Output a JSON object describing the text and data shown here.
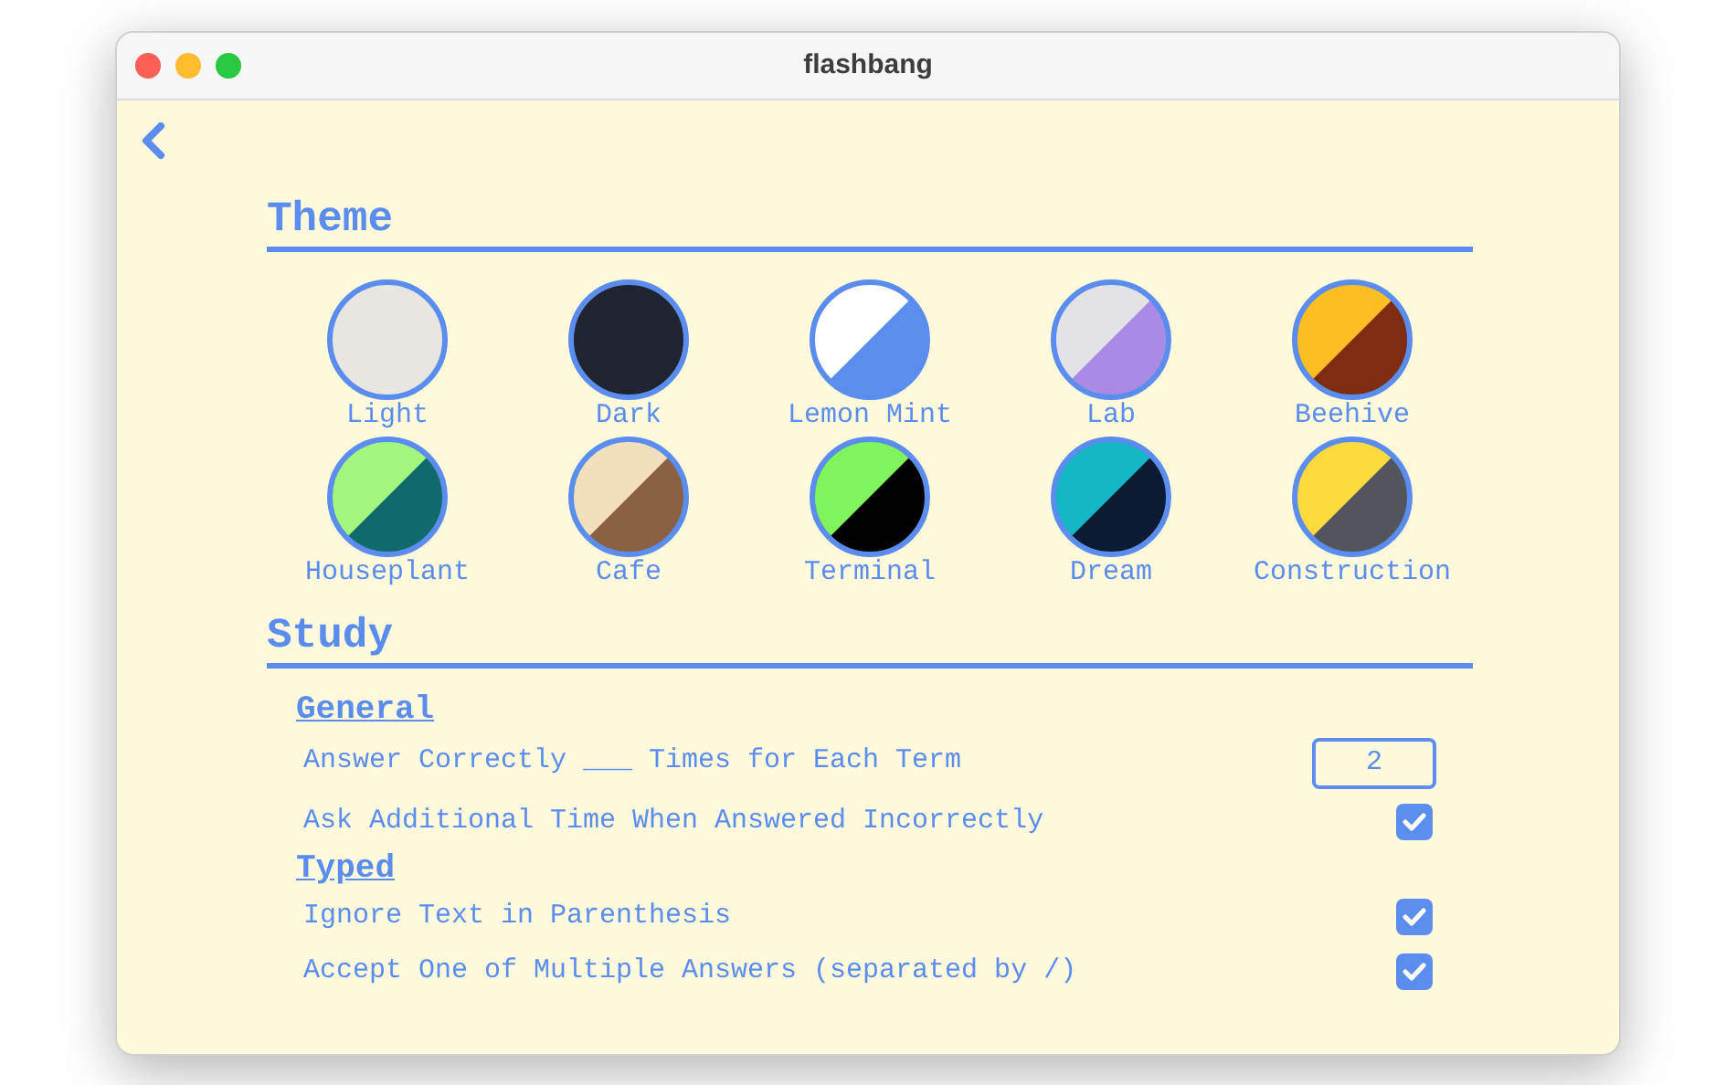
{
  "window": {
    "title": "flashbang"
  },
  "sections": [
    {
      "title": "Theme",
      "themes": [
        {
          "label": "Light",
          "halves": [
            {
              "color": "#e8e6e1"
            },
            {
              "color": "#e8e6e1"
            }
          ]
        },
        {
          "label": "Dark",
          "halves": [
            {
              "color": "#1f2430"
            },
            {
              "color": "#1f2430"
            }
          ]
        },
        {
          "label": "Lemon Mint",
          "halves": [
            {
              "color": "#ffffff"
            },
            {
              "color": "#5b8def"
            }
          ]
        },
        {
          "label": "Lab",
          "halves": [
            {
              "color": "#e3e3e6"
            },
            {
              "color": "#a98be6"
            }
          ]
        },
        {
          "label": "Beehive",
          "halves": [
            {
              "color": "#fbbf24"
            },
            {
              "color": "#7c2d12"
            }
          ]
        },
        {
          "label": "Houseplant",
          "halves": [
            {
              "color": "#a3f77f"
            },
            {
              "color": "#0f6b6b"
            }
          ]
        },
        {
          "label": "Cafe",
          "halves": [
            {
              "color": "#f2dfbe"
            },
            {
              "color": "#8a6142"
            }
          ]
        },
        {
          "label": "Terminal",
          "halves": [
            {
              "color": "#7ef55a"
            },
            {
              "color": "#000000"
            }
          ]
        },
        {
          "label": "Dream",
          "halves": [
            {
              "color": "#14b8c4"
            },
            {
              "color": "#0c1a33"
            }
          ]
        },
        {
          "label": "Construction",
          "halves": [
            {
              "color": "#fcd93c"
            },
            {
              "color": "#52555c"
            }
          ]
        }
      ]
    },
    {
      "title": "Study",
      "groups": [
        {
          "title": "General",
          "settings": [
            {
              "kind": "number",
              "label": "Answer Correctly ___ Times for Each Term",
              "value": "2"
            },
            {
              "kind": "checkbox",
              "label": "Ask Additional Time When Answered Incorrectly",
              "checked": true
            }
          ]
        },
        {
          "title": "Typed",
          "settings": [
            {
              "kind": "checkbox",
              "label": "Ignore Text in Parenthesis",
              "checked": true
            },
            {
              "kind": "checkbox",
              "label": "Accept One of Multiple Answers (separated by /)",
              "checked": true
            }
          ]
        }
      ]
    }
  ]
}
